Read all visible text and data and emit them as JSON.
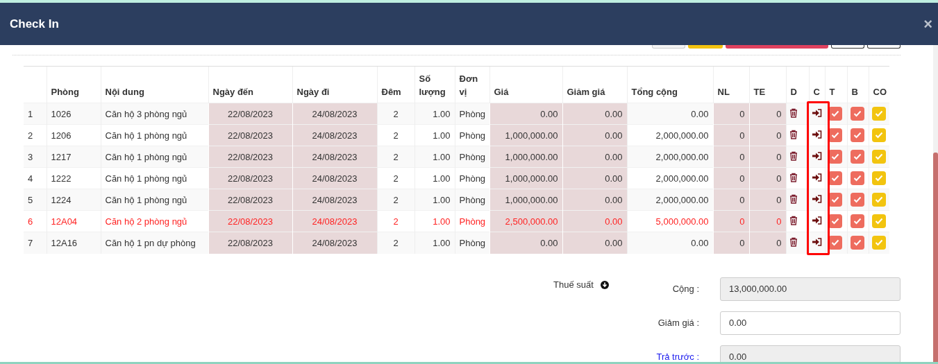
{
  "window": {
    "title": "Check In",
    "close": "×"
  },
  "toolbar": [
    {
      "kind": "default"
    },
    {
      "kind": "warning"
    },
    {
      "kind": "danger"
    },
    {
      "kind": "outline"
    },
    {
      "kind": "outline"
    }
  ],
  "table": {
    "columns": [
      {
        "outlined": false
      },
      {
        "label": "Phòng",
        "outlined": false
      },
      {
        "label": "Nội dung",
        "outlined": false
      },
      {
        "label": "Ngày đến",
        "outlined": false
      },
      {
        "label": "Ngày đi",
        "outlined": false
      },
      {
        "label": "Đêm",
        "outlined": false
      },
      {
        "label": "Số lượng",
        "outlined": false
      },
      {
        "label": "Đơn vị",
        "outlined": false
      },
      {
        "label": "Giá",
        "outlined": false
      },
      {
        "label": "Giảm giá",
        "outlined": false
      },
      {
        "label": "Tổng cộng",
        "outlined": false
      },
      {
        "label": "NL",
        "outlined": false
      },
      {
        "label": "TE",
        "outlined": false
      },
      {
        "label": "D",
        "outlined": false
      },
      {
        "label": "C",
        "outlined": true
      },
      {
        "label": "T",
        "outlined": false
      },
      {
        "label": "B",
        "outlined": false
      },
      {
        "label": "CO",
        "outlined": false
      }
    ],
    "rows": [
      {
        "cells": [
          "1",
          "1026",
          "Căn hộ 3 phòng ngủ",
          "22/08/2023",
          "24/08/2023",
          "2",
          "1.00",
          "Phòng",
          "0.00",
          "0.00",
          "0.00",
          "0",
          "0"
        ],
        "highlight": false,
        "t_checked": true,
        "b_checked": true,
        "co_checked": true
      },
      {
        "cells": [
          "2",
          "1206",
          "Căn hộ 1 phòng ngủ",
          "22/08/2023",
          "24/08/2023",
          "2",
          "1.00",
          "Phòng",
          "1,000,000.00",
          "0.00",
          "2,000,000.00",
          "0",
          "0"
        ],
        "highlight": false,
        "t_checked": true,
        "b_checked": true,
        "co_checked": true
      },
      {
        "cells": [
          "3",
          "1217",
          "Căn hộ 1 phòng ngủ",
          "22/08/2023",
          "24/08/2023",
          "2",
          "1.00",
          "Phòng",
          "1,000,000.00",
          "0.00",
          "2,000,000.00",
          "0",
          "0"
        ],
        "highlight": false,
        "t_checked": true,
        "b_checked": true,
        "co_checked": true
      },
      {
        "cells": [
          "4",
          "1222",
          "Căn hộ 1 phòng ngủ",
          "22/08/2023",
          "24/08/2023",
          "2",
          "1.00",
          "Phòng",
          "1,000,000.00",
          "0.00",
          "2,000,000.00",
          "0",
          "0"
        ],
        "highlight": false,
        "t_checked": true,
        "b_checked": true,
        "co_checked": true
      },
      {
        "cells": [
          "5",
          "1224",
          "Căn hộ 1 phòng ngủ",
          "22/08/2023",
          "24/08/2023",
          "2",
          "1.00",
          "Phòng",
          "1,000,000.00",
          "0.00",
          "2,000,000.00",
          "0",
          "0"
        ],
        "highlight": false,
        "t_checked": true,
        "b_checked": true,
        "co_checked": true
      },
      {
        "cells": [
          "6",
          "12A04",
          "Căn hộ 2 phòng ngủ",
          "22/08/2023",
          "24/08/2023",
          "2",
          "1.00",
          "Phòng",
          "2,500,000.00",
          "0.00",
          "5,000,000.00",
          "0",
          "0"
        ],
        "highlight": true,
        "t_checked": true,
        "b_checked": true,
        "co_checked": true
      },
      {
        "cells": [
          "7",
          "12A16",
          "Căn hộ 1 pn dự phòng",
          "22/08/2023",
          "24/08/2023",
          "2",
          "1.00",
          "Phòng",
          "0.00",
          "0.00",
          "0.00",
          "0",
          "0"
        ],
        "highlight": false,
        "t_checked": true,
        "b_checked": true,
        "co_checked": true
      }
    ]
  },
  "tax": {
    "label": "Thuế suất"
  },
  "summary": [
    {
      "label": "Cộng :",
      "value": "13,000,000.00",
      "readonly": true,
      "link": false
    },
    {
      "label": "Giảm giá :",
      "value": "0.00",
      "readonly": false,
      "link": false
    },
    {
      "label": "Trả trước :",
      "value": "0.00",
      "readonly": true,
      "link": true
    }
  ]
}
